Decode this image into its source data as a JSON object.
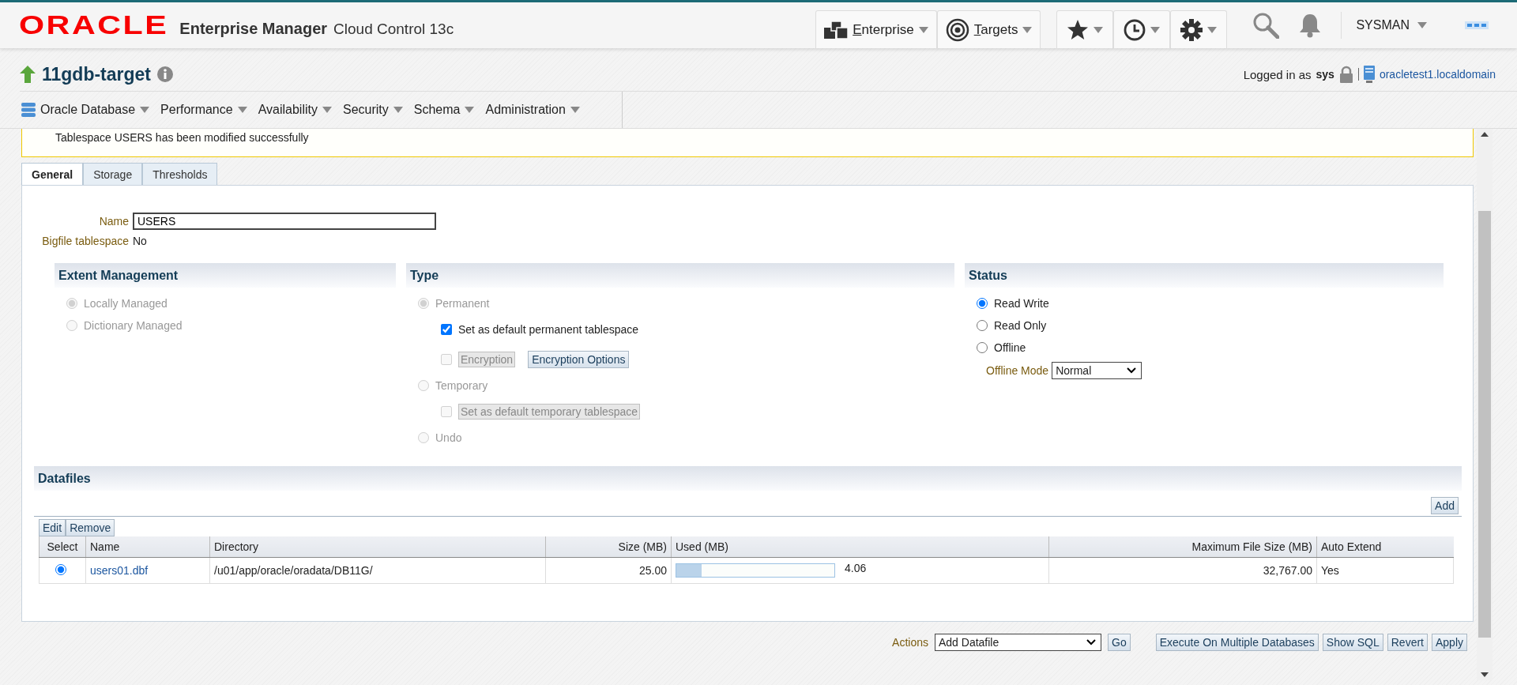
{
  "header": {
    "logo": "ORACLE",
    "product": "Enterprise Manager",
    "subtitle": "Cloud Control 13c",
    "nav_menus": [
      {
        "kind": "enterprise",
        "label": "Enterprise"
      },
      {
        "kind": "targets",
        "label": "Targets"
      }
    ],
    "icon_menus": [
      {
        "kind": "star"
      },
      {
        "kind": "clock"
      },
      {
        "kind": "gear"
      }
    ],
    "user": "SYSMAN"
  },
  "target": {
    "name": "11gdb-target",
    "logged_in_label": "Logged in as",
    "user": "sys",
    "host": "oracletest1.localdomain"
  },
  "menu": [
    {
      "kind": "database",
      "label": "Oracle Database"
    },
    {
      "kind": "plain",
      "label": "Performance"
    },
    {
      "kind": "plain",
      "label": "Availability"
    },
    {
      "kind": "plain",
      "label": "Security"
    },
    {
      "kind": "plain",
      "label": "Schema"
    },
    {
      "kind": "plain",
      "label": "Administration"
    }
  ],
  "message": "Tablespace USERS has been modified successfully",
  "tabs": [
    {
      "label": "General",
      "selected": true
    },
    {
      "label": "Storage",
      "selected": false
    },
    {
      "label": "Thresholds",
      "selected": false
    }
  ],
  "fields": [
    {
      "kind": "input",
      "label": "Name",
      "value": "USERS"
    },
    {
      "kind": "text",
      "label": "Bigfile tablespace",
      "value": "No"
    }
  ],
  "extent_management": {
    "title": "Extent Management",
    "options": [
      {
        "label": "Locally Managed",
        "selected": true,
        "disabled": true
      },
      {
        "label": "Dictionary Managed",
        "selected": false,
        "disabled": true
      }
    ]
  },
  "type": {
    "title": "Type",
    "options": [
      {
        "label": "Permanent",
        "selected": true,
        "disabled": true,
        "children": [
          {
            "label": "Set as default permanent tablespace",
            "checked": true,
            "disabled": false
          },
          {
            "label": "Encryption",
            "checked": false,
            "disabled": true,
            "button": "Encryption Options"
          }
        ]
      },
      {
        "label": "Temporary",
        "selected": false,
        "disabled": true,
        "children": [
          {
            "label": "Set as default temporary tablespace",
            "checked": false,
            "disabled": true
          }
        ]
      },
      {
        "label": "Undo",
        "selected": false,
        "disabled": true
      }
    ]
  },
  "status": {
    "title": "Status",
    "options": [
      {
        "label": "Read Write",
        "selected": true,
        "disabled": false
      },
      {
        "label": "Read Only",
        "selected": false,
        "disabled": false
      },
      {
        "label": "Offline",
        "selected": false,
        "disabled": false
      }
    ],
    "offline_mode_label": "Offline Mode",
    "offline_mode": "Normal"
  },
  "datafiles": {
    "title": "Datafiles",
    "add_button": "Add",
    "toolbar": [
      "Edit",
      "Remove"
    ],
    "columns": [
      "Select",
      "Name",
      "Directory",
      "Size (MB)",
      "Used (MB)",
      "Maximum File Size (MB)",
      "Auto Extend"
    ],
    "rows": [
      {
        "selected": true,
        "name": "users01.dbf",
        "directory": "/u01/app/oracle/oradata/DB11G/",
        "size": "25.00",
        "level": 0.16,
        "used": "4.06",
        "max_size": "32,767.00",
        "auto_extend": "Yes"
      }
    ]
  },
  "actions": {
    "label": "Actions",
    "value": "Add Datafile",
    "go": "Go",
    "buttons": [
      "Execute On Multiple Databases",
      "Show SQL",
      "Revert",
      "Apply"
    ]
  }
}
